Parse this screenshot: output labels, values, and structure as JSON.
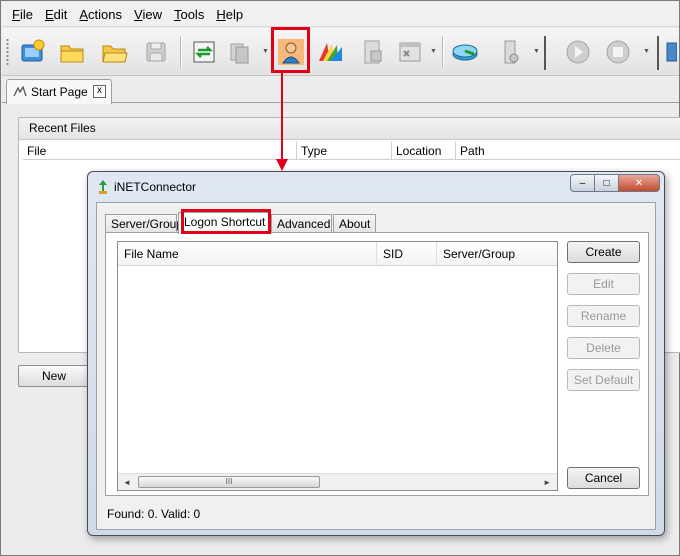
{
  "menubar": {
    "items": [
      {
        "label": "File",
        "accel": "F",
        "rest": "ile"
      },
      {
        "label": "Edit",
        "accel": "E",
        "rest": "dit"
      },
      {
        "label": "Actions",
        "accel": "A",
        "rest": "ctions"
      },
      {
        "label": "View",
        "accel": "V",
        "rest": "iew"
      },
      {
        "label": "Tools",
        "accel": "T",
        "rest": "ools"
      },
      {
        "label": "Help",
        "accel": "H",
        "rest": "elp"
      }
    ]
  },
  "toolbar": {
    "icons": [
      "new-connection-icon",
      "open-folder-icon",
      "open-folder-alt-icon",
      "save-icon",
      "transfer-icon",
      "copy-files-icon",
      "logon-shortcut-user-icon",
      "color-palette-icon",
      "document-icon",
      "window-icon",
      "connect-icon",
      "settings-icon",
      "play-icon",
      "stop-icon"
    ],
    "highlight_color": "#e0001a"
  },
  "start_tab": {
    "label": "Start Page",
    "close": "x"
  },
  "recent_files": {
    "title": "Recent Files",
    "columns": [
      "File",
      "Type",
      "Location",
      "Path"
    ]
  },
  "new_button": "New",
  "dialog": {
    "title": "iNETConnector",
    "controls": {
      "minimize": "–",
      "maximize": "□",
      "close": "✕"
    },
    "tabs": [
      "Server/Group",
      "Logon Shortcut",
      "Advanced",
      "About"
    ],
    "active_tab": "Logon Shortcut",
    "grid": {
      "columns": [
        "File Name",
        "SID",
        "Server/Group"
      ],
      "scroll_left": "◄",
      "scroll_right": "►",
      "thumb_grip": "III"
    },
    "buttons": {
      "create": "Create",
      "edit": "Edit",
      "rename": "Rename",
      "delete": "Delete",
      "set_default": "Set Default",
      "cancel": "Cancel"
    },
    "status": "Found: 0. Valid: 0"
  }
}
